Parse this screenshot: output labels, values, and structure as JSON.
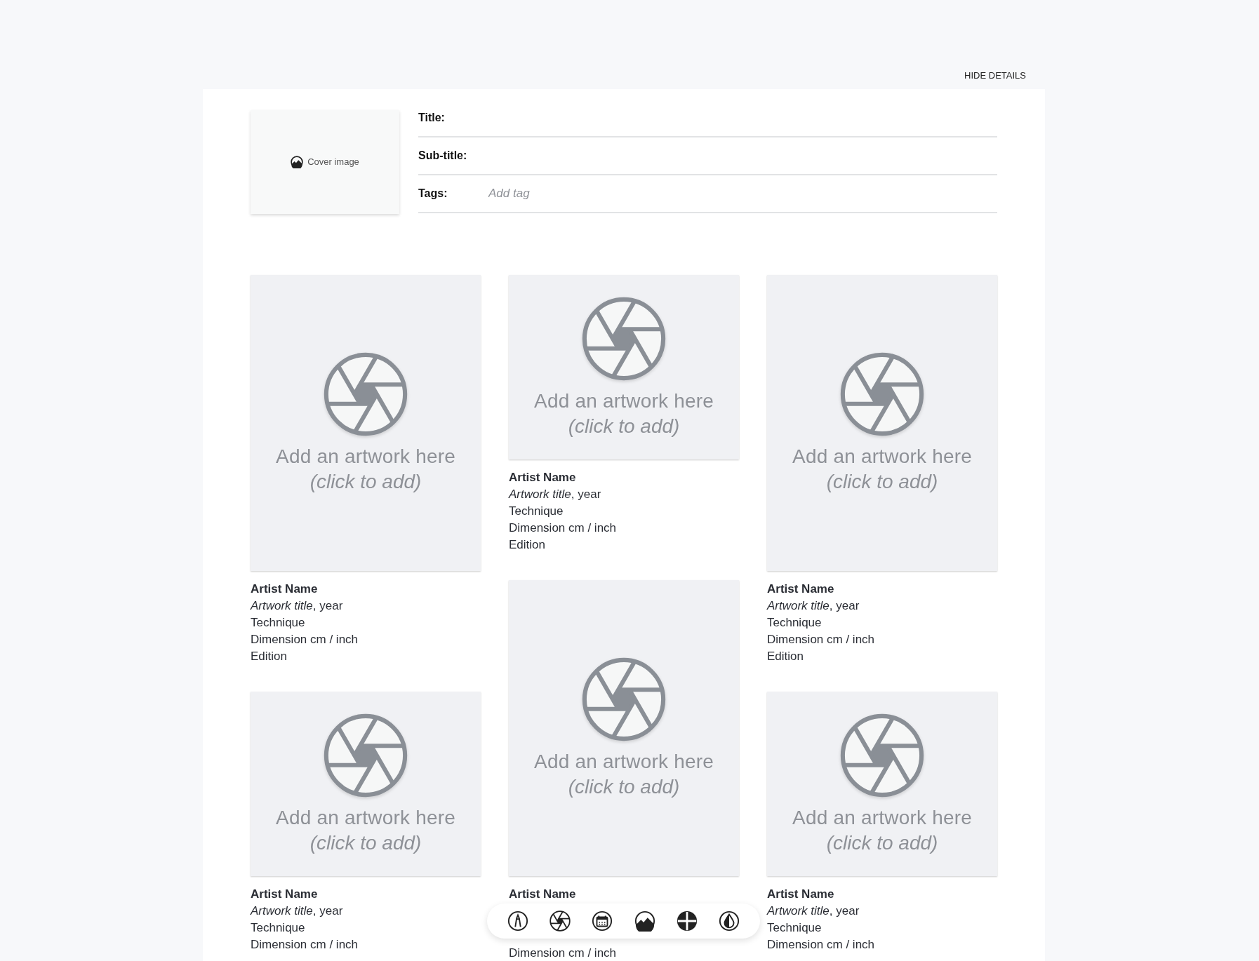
{
  "header": {
    "toggle": "HIDE DETAILS"
  },
  "cover": {
    "label": "Cover image"
  },
  "fields": [
    {
      "kind": "text",
      "label": "Title:"
    },
    {
      "kind": "text",
      "label": "Sub-title:"
    },
    {
      "kind": "tags",
      "label": "Tags:",
      "placeholder": "Add tag"
    }
  ],
  "columns": [
    {
      "cards": [
        {
          "tall": true,
          "prompt": "Add an artwork here",
          "hint": "(click to add)",
          "caption": [
            "Artist Name",
            "*Artwork title*, year",
            "Technique",
            "Dimension cm / inch",
            "Edition"
          ]
        },
        {
          "tall": false,
          "prompt": "Add an artwork here",
          "hint": "(click to add)",
          "caption": [
            "Artist Name",
            "*Artwork title*, year",
            "Technique",
            "Dimension cm / inch"
          ]
        }
      ]
    },
    {
      "cards": [
        {
          "tall": false,
          "prompt": "Add an artwork here",
          "hint": "(click to add)",
          "caption": [
            "Artist Name",
            "*Artwork title*, year",
            "Technique",
            "Dimension cm / inch",
            "Edition"
          ]
        },
        {
          "tall": true,
          "under_toolbar": true,
          "prompt": "Add an artwork here",
          "hint": "(click to add)",
          "caption": [
            "Artist Name",
            "Dimension cm / inch"
          ]
        }
      ]
    },
    {
      "cards": [
        {
          "tall": true,
          "prompt": "Add an artwork here",
          "hint": "(click to add)",
          "caption": [
            "Artist Name",
            "*Artwork title*, year",
            "Technique",
            "Dimension cm / inch",
            "Edition"
          ]
        },
        {
          "tall": false,
          "prompt": "Add an artwork here",
          "hint": "(click to add)",
          "caption": [
            "Artist Name",
            "*Artwork title*, year",
            "Technique",
            "Dimension cm / inch"
          ]
        }
      ]
    }
  ],
  "toolbar": [
    {
      "kind": "pen"
    },
    {
      "kind": "aperture"
    },
    {
      "kind": "calendar"
    },
    {
      "kind": "landscape"
    },
    {
      "kind": "cross"
    },
    {
      "kind": "contrast"
    }
  ]
}
